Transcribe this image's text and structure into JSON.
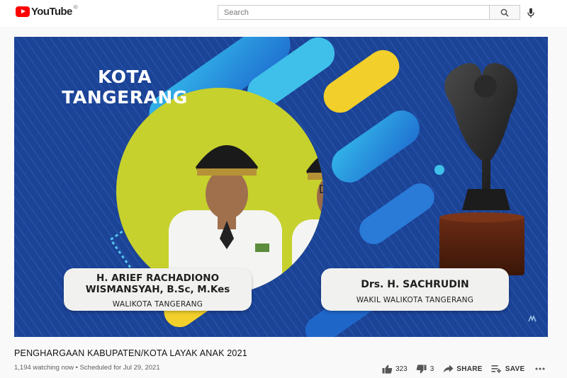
{
  "header": {
    "logo_text": "YouTube",
    "country_code": "ID",
    "search_placeholder": "Search"
  },
  "video": {
    "thumbnail": {
      "heading_line1": "KOTA",
      "heading_line2": "TANGERANG",
      "left_card": {
        "name_line1": "H. ARIEF RACHADIONO",
        "name_line2": "WISMANSYAH, B.Sc, M.Kes",
        "role": "WALIKOTA TANGERANG"
      },
      "right_card": {
        "name": "Drs. H. SACHRUDIN",
        "role": "WAKIL WALIKOTA TANGERANG"
      }
    },
    "title": "PENGHARGAAN KABUPATEN/KOTA LAYAK ANAK 2021",
    "meta": "1,194 watching now • Scheduled for Jul 29, 2021",
    "actions": {
      "likes": "323",
      "dislikes": "3",
      "share_label": "SHARE",
      "save_label": "SAVE"
    }
  },
  "colors": {
    "brand_red": "#ff0000",
    "thumbnail_blue": "#1a3f8f",
    "circle_lime": "#c7d12d",
    "accent_orange": "#f39a1f"
  },
  "icons": [
    "play-logo-icon",
    "search-icon",
    "mic-icon",
    "thumbs-up-icon",
    "thumbs-down-icon",
    "share-icon",
    "save-playlist-icon",
    "more-icon",
    "corner-mark-icon"
  ]
}
